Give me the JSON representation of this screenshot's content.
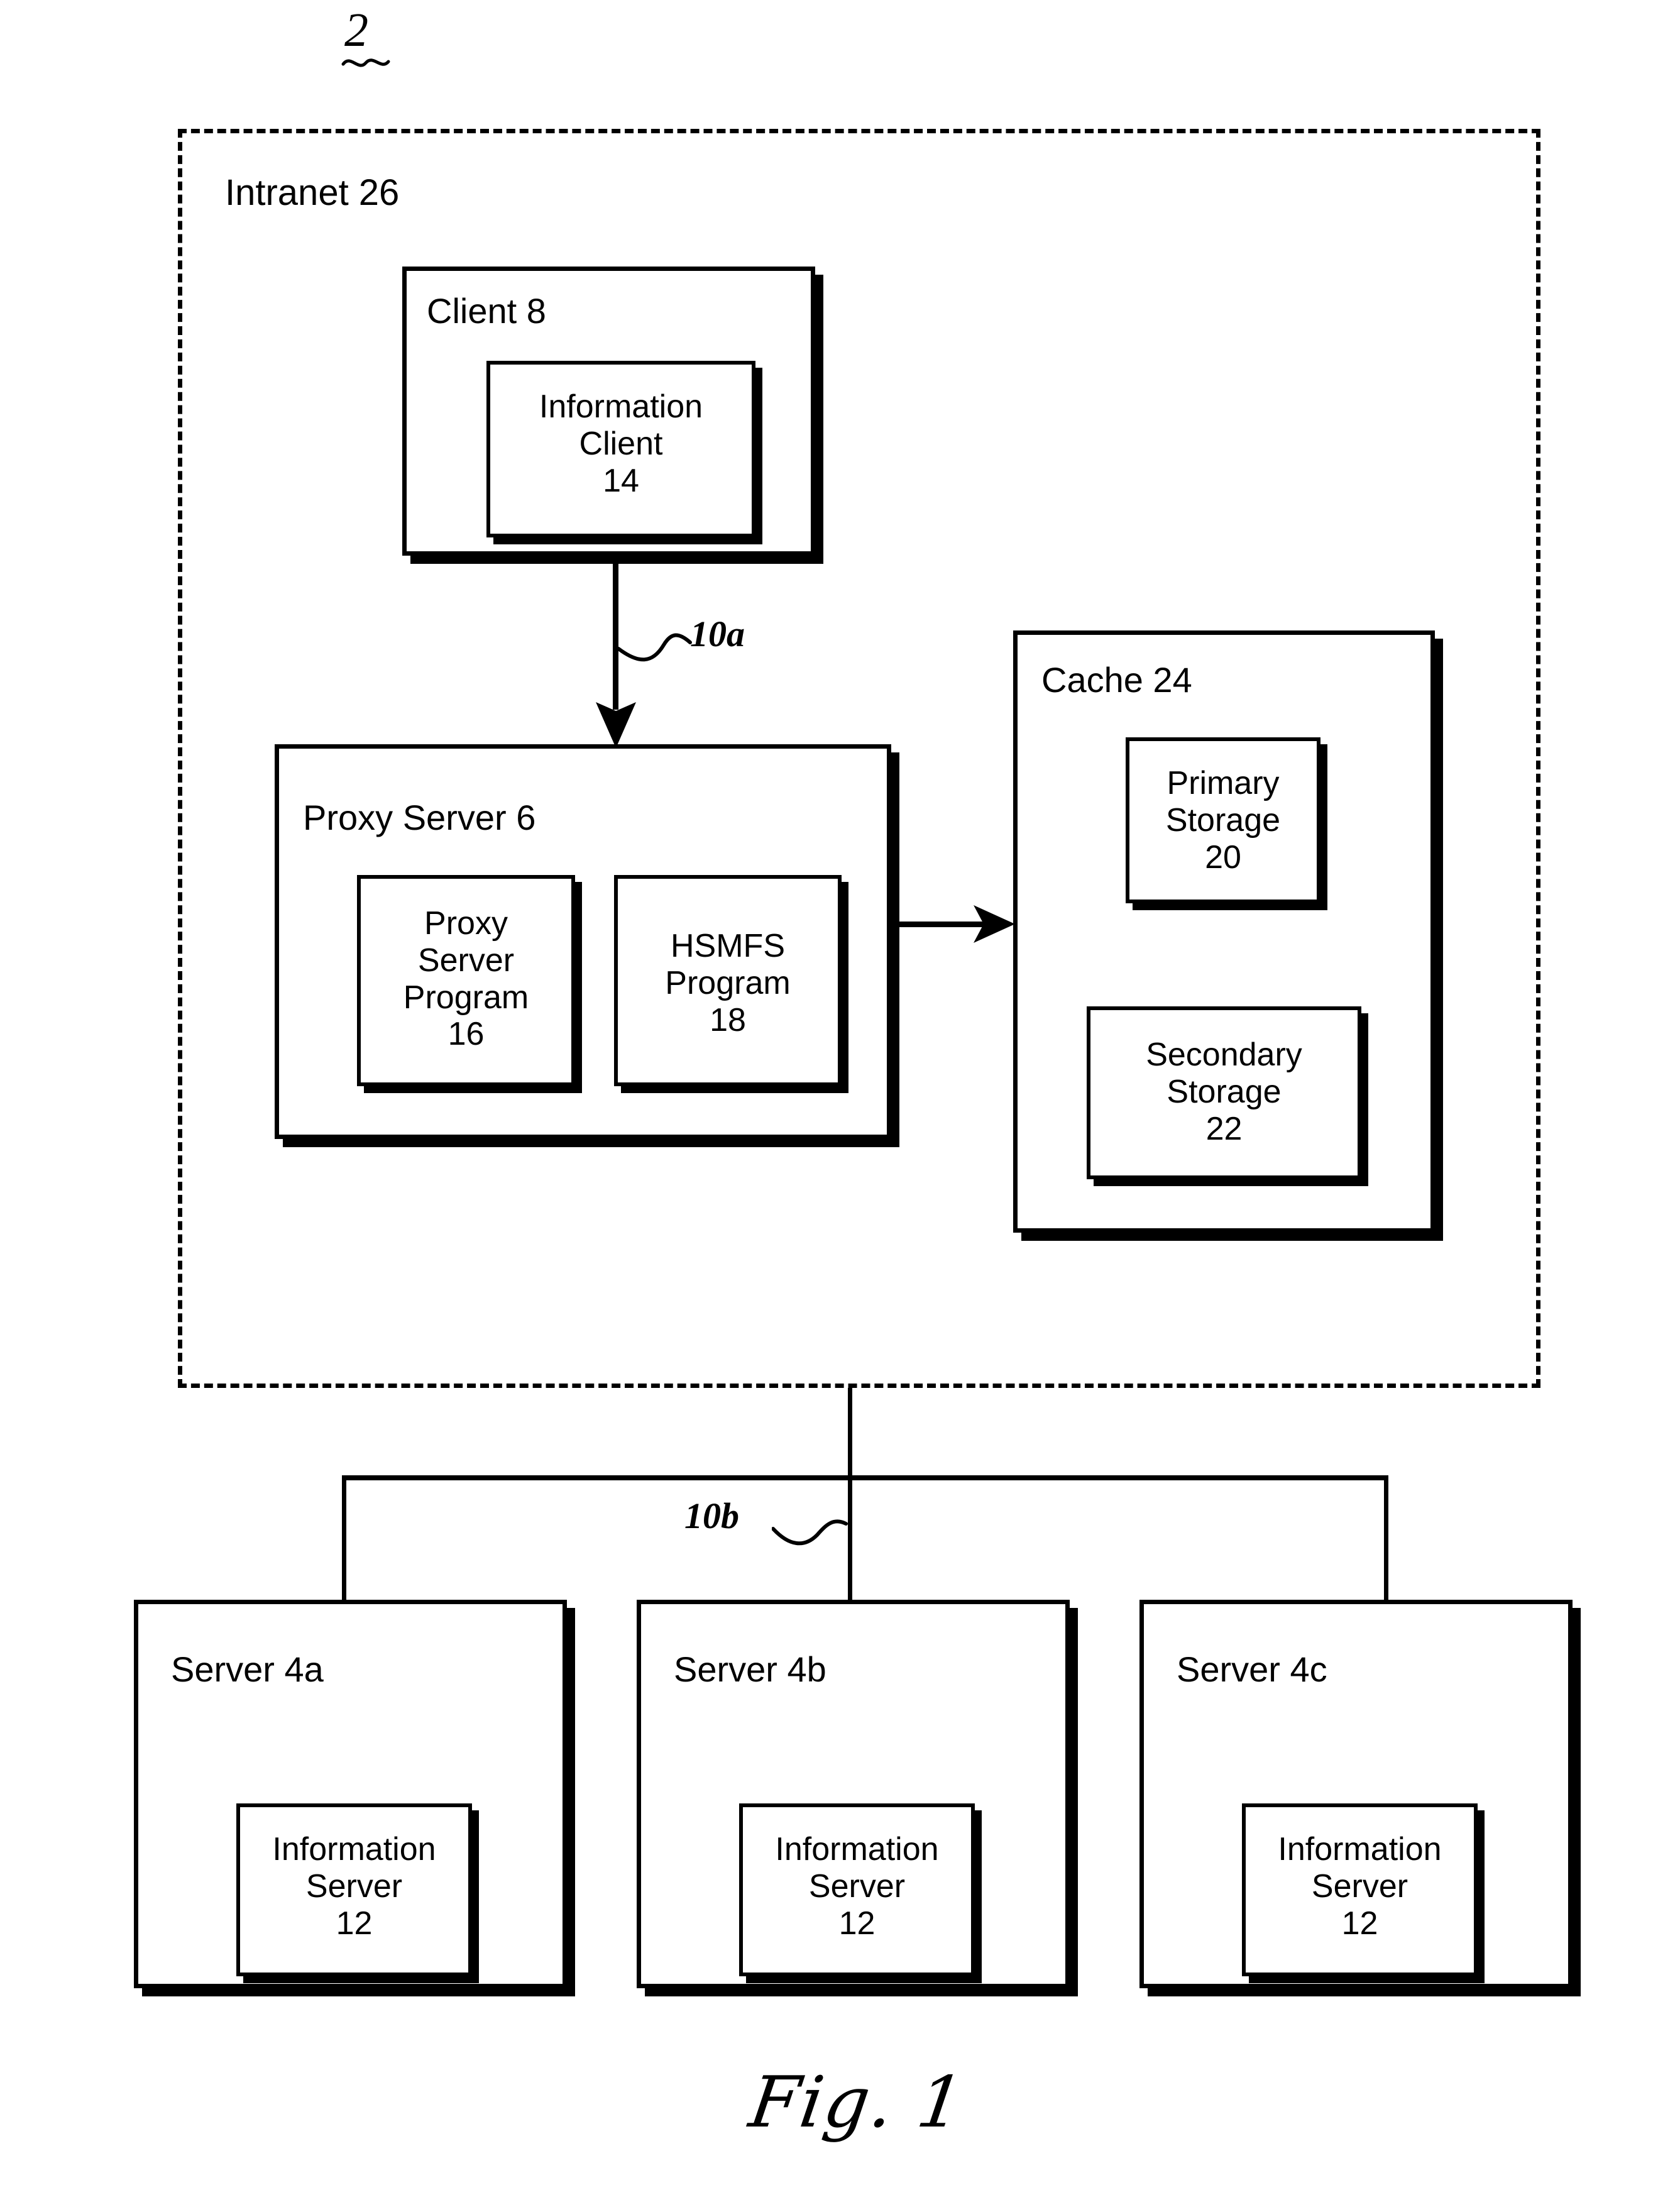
{
  "figure": {
    "ref_numeral": "2",
    "caption": "Fig. 1"
  },
  "intranet": {
    "label": "Intranet 26"
  },
  "client": {
    "title": "Client 8",
    "inner": {
      "label": "Information\nClient\n14"
    }
  },
  "proxy_server": {
    "title": "Proxy Server 6",
    "programs": [
      {
        "label": "Proxy\nServer\nProgram\n16"
      },
      {
        "label": "HSMFS\nProgram\n18"
      }
    ]
  },
  "cache": {
    "title": "Cache 24",
    "storages": [
      {
        "label": "Primary\nStorage\n20"
      },
      {
        "label": "Secondary\nStorage\n22"
      }
    ]
  },
  "connectors": {
    "client_to_proxy_label": "10a",
    "network_bus_label": "10b"
  },
  "servers": [
    {
      "title": "Server 4a",
      "inner": {
        "label": "Information\nServer\n12"
      }
    },
    {
      "title": "Server 4b",
      "inner": {
        "label": "Information\nServer\n12"
      }
    },
    {
      "title": "Server 4c",
      "inner": {
        "label": "Information\nServer\n12"
      }
    }
  ]
}
